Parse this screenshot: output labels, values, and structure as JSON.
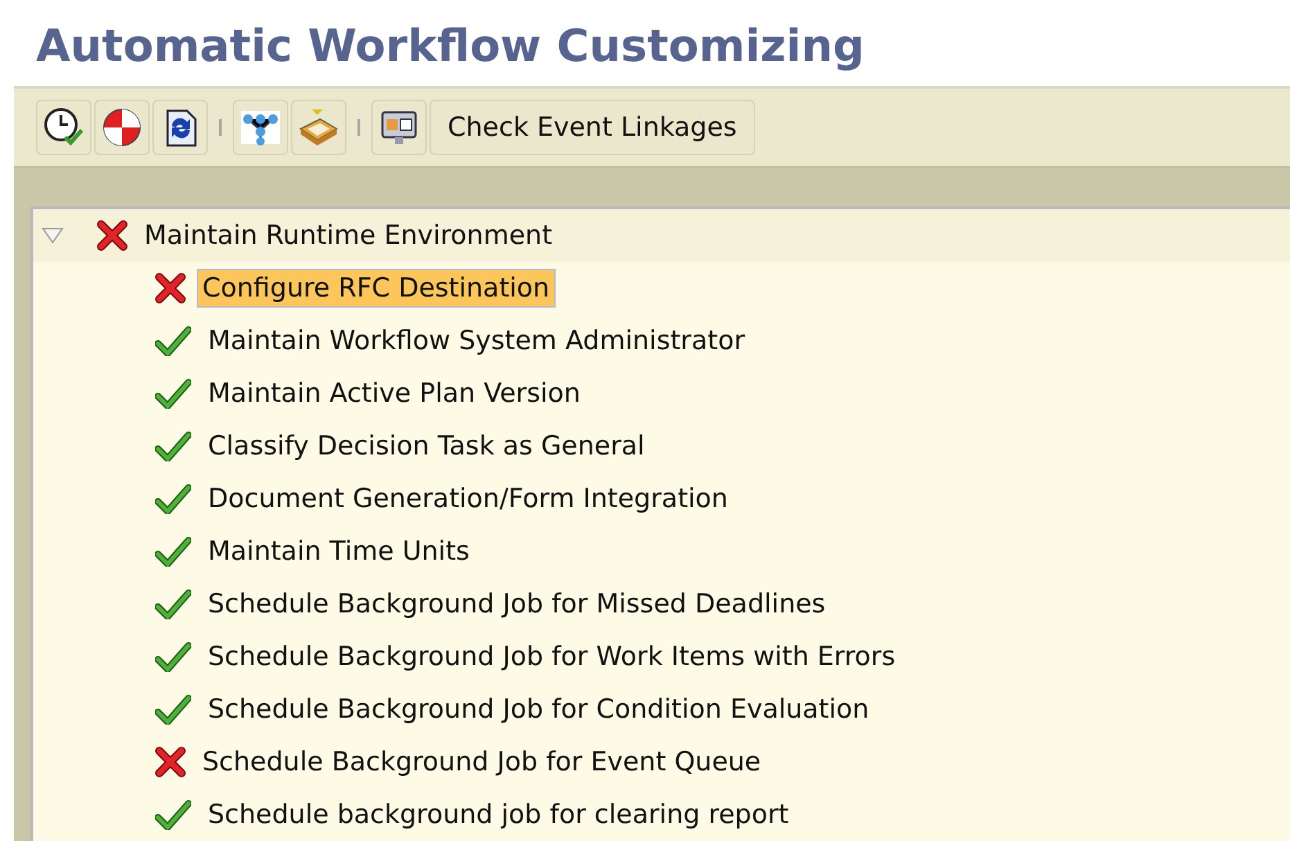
{
  "title": "Automatic Workflow Customizing",
  "toolbar": {
    "groups": [
      [
        {
          "kind": "clock-check"
        },
        {
          "kind": "lifebuoy"
        },
        {
          "kind": "refresh-document"
        }
      ],
      [
        {
          "kind": "network"
        },
        {
          "kind": "eraser"
        }
      ],
      [
        {
          "kind": "monitor"
        },
        {
          "kind": "text",
          "label": "Check Event Linkages"
        }
      ]
    ]
  },
  "tree": {
    "label": "Maintain Runtime Environment",
    "kind": "error",
    "expanded": true,
    "selected": false,
    "children": [
      {
        "label": "Configure RFC Destination",
        "kind": "error",
        "selected": true
      },
      {
        "label": "Maintain Workflow System Administrator",
        "kind": "ok",
        "selected": false
      },
      {
        "label": "Maintain Active Plan Version",
        "kind": "ok",
        "selected": false
      },
      {
        "label": "Classify Decision Task as General",
        "kind": "ok",
        "selected": false
      },
      {
        "label": "Document Generation/Form Integration",
        "kind": "ok",
        "selected": false
      },
      {
        "label": "Maintain Time Units",
        "kind": "ok",
        "selected": false
      },
      {
        "label": "Schedule Background Job for Missed Deadlines",
        "kind": "ok",
        "selected": false
      },
      {
        "label": "Schedule Background Job for Work Items with Errors",
        "kind": "ok",
        "selected": false
      },
      {
        "label": "Schedule Background Job for Condition Evaluation",
        "kind": "ok",
        "selected": false
      },
      {
        "label": "Schedule Background Job for Event Queue",
        "kind": "error",
        "selected": false
      },
      {
        "label": "Schedule background job for clearing report",
        "kind": "ok",
        "selected": false
      }
    ]
  }
}
